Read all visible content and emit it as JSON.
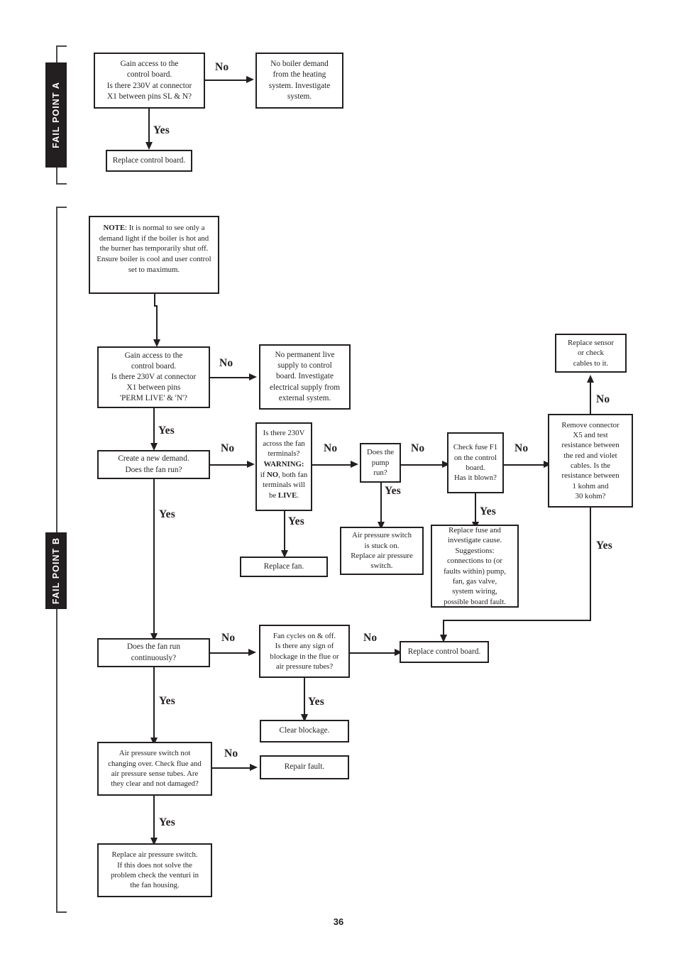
{
  "page": {
    "number": "36"
  },
  "fail_points": [
    {
      "label": "FAIL POINT A"
    },
    {
      "label": "FAIL POINT B"
    }
  ],
  "section_a": {
    "boxes": {
      "gain_access_sl_n": "Gain access to the\ncontrol board.\nIs there 230V at connector\nX1 between pins SL & N?",
      "no_boiler_demand": "No boiler demand\nfrom the heating\nsystem. Investigate\nsystem.",
      "replace_control_board": "Replace control board."
    },
    "edges": {
      "no_1": "No",
      "yes_1": "Yes"
    }
  },
  "section_b": {
    "note": {
      "lead": "NOTE",
      "text": ": It is normal to see only a demand light if the boiler is hot and the burner has temporarily shut off.\nEnsure boiler is cool and user control set to maximum."
    },
    "boxes": {
      "gain_access_perm_live": "Gain access to the\ncontrol board.\nIs there 230V at connector\nX1 between pins\n'PERM LIVE' & 'N'?",
      "no_permanent_live": "No permanent live\nsupply to control\nboard. Investigate\nelectrical supply from\nexternal system.",
      "create_new_demand": "Create a new demand.\nDoes the fan run?",
      "fan_terminals_230v_a": "Is there 230V\nacross the fan\nterminals?\n",
      "fan_terminals_230v_warning": "WARNING:",
      "fan_terminals_230v_b": "\nif ",
      "fan_terminals_230v_no": "NO",
      "fan_terminals_230v_c": ", both fan\nterminals will\nbe ",
      "fan_terminals_230v_live": "LIVE",
      "fan_terminals_230v_d": ".",
      "replace_fan": "Replace fan.",
      "does_pump_run": "Does the\npump\nrun?",
      "air_pressure_stuck": "Air pressure switch\nis stuck on.\nReplace air pressure\nswitch.",
      "check_fuse_f1": "Check fuse F1\non the control\nboard.\nHas it blown?",
      "replace_fuse": "Replace fuse and\ninvestigate cause.\nSuggestions:\nconnections to (or\nfaults within) pump,\nfan, gas valve,\nsystem wiring,\npossible board fault.",
      "remove_connector_x5": "Remove connector\nX5 and test\nresistance between\nthe red and violet\ncables. Is the\nresistance between\n1 kohm and\n30 kohm?",
      "replace_sensor": "Replace sensor\nor check\ncables to it.",
      "does_fan_run_continuously": "Does the fan run\ncontinuously?",
      "fan_cycles": "Fan cycles on & off.\nIs there any sign of\nblockage in the flue or\nair pressure tubes?",
      "replace_control_board_2": "Replace control board.",
      "clear_blockage": "Clear blockage.",
      "repair_fault": "Repair fault.",
      "air_pressure_not_changing": "Air pressure switch not\nchanging over. Check flue and\nair pressure sense tubes. Are\nthey clear and not damaged?",
      "replace_air_pressure_switch": "Replace air pressure switch.\nIf this does not solve the\nproblem check the venturi in\nthe fan housing."
    },
    "edges": {
      "no_perm_live": "No",
      "yes_perm_live": "Yes",
      "no_create_demand": "No",
      "yes_create_demand": "Yes",
      "yes_fan_terminals": "Yes",
      "no_fan_terminals": "No",
      "yes_pump": "Yes",
      "no_pump": "No",
      "yes_fuse": "Yes",
      "no_fuse": "No",
      "no_x5": "No",
      "yes_x5": "Yes",
      "no_fan_continuous": "No",
      "yes_fan_continuous": "Yes",
      "no_fan_cycles": "No",
      "yes_fan_cycles": "Yes",
      "no_tubes": "No",
      "yes_tubes": "Yes"
    }
  },
  "colors": {
    "ink": "#231f20",
    "tab_bg": "#231f20",
    "tab_text": "#ffffff"
  }
}
